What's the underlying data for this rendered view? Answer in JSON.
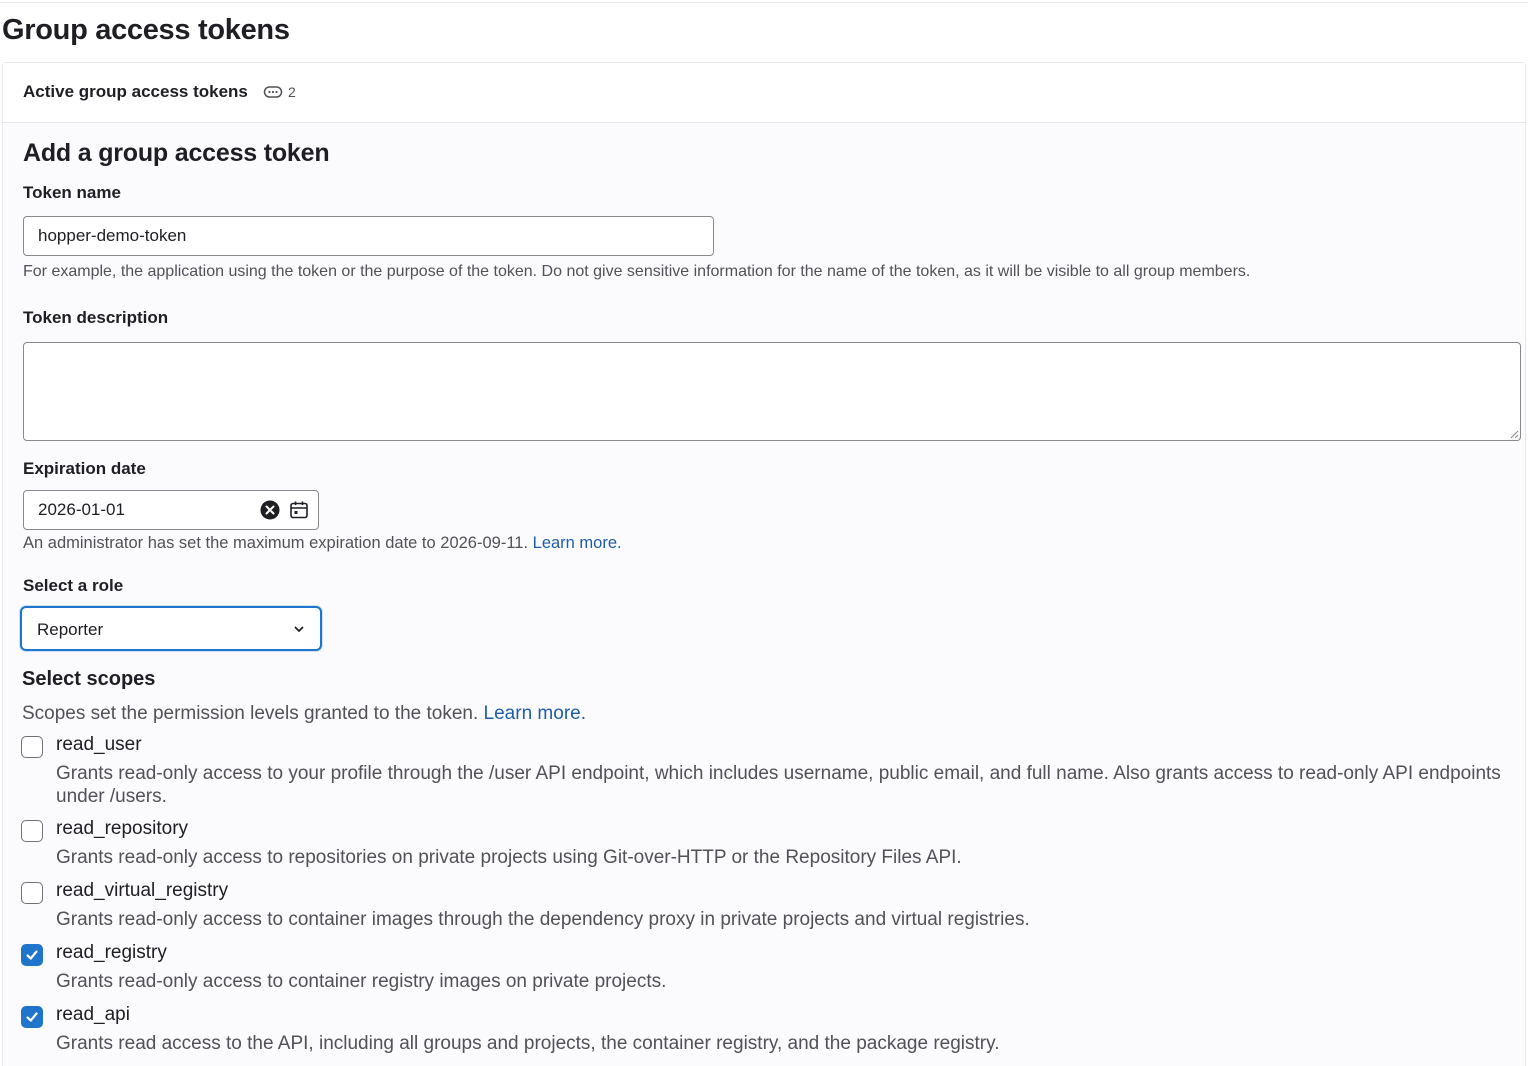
{
  "page": {
    "title": "Group access tokens"
  },
  "active_tokens": {
    "label": "Active group access tokens",
    "count": "2",
    "icon": "token-icon"
  },
  "form": {
    "title": "Add a group access token",
    "token_name": {
      "label": "Token name",
      "value": "hopper-demo-token",
      "help": "For example, the application using the token or the purpose of the token. Do not give sensitive information for the name of the token, as it will be visible to all group members."
    },
    "token_description": {
      "label": "Token description",
      "value": ""
    },
    "expiration": {
      "label": "Expiration date",
      "value": "2026-01-01",
      "help": "An administrator has set the maximum expiration date to 2026-09-11.",
      "help_link": "Learn more."
    },
    "role": {
      "label": "Select a role",
      "value": "Reporter"
    },
    "scopes": {
      "title": "Select scopes",
      "help": "Scopes set the permission levels granted to the token.",
      "help_link": "Learn more.",
      "items": [
        {
          "name": "read_user",
          "checked": false,
          "description": "Grants read-only access to your profile through the /user API endpoint, which includes username, public email, and full name. Also grants access to read-only API endpoints under /users."
        },
        {
          "name": "read_repository",
          "checked": false,
          "description": "Grants read-only access to repositories on private projects using Git-over-HTTP or the Repository Files API."
        },
        {
          "name": "read_virtual_registry",
          "checked": false,
          "description": "Grants read-only access to container images through the dependency proxy in private projects and virtual registries."
        },
        {
          "name": "read_registry",
          "checked": true,
          "description": "Grants read-only access to container registry images on private projects."
        },
        {
          "name": "read_api",
          "checked": true,
          "description": "Grants read access to the API, including all groups and projects, the container registry, and the package registry."
        }
      ]
    }
  },
  "colors": {
    "accent": "#1f75cb",
    "link": "#1f5fa8",
    "text": "#1f1e24",
    "muted": "#535158"
  }
}
